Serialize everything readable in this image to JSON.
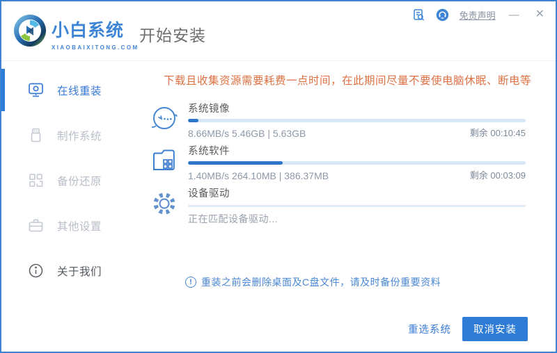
{
  "header": {
    "brand_name": "小白系统",
    "brand_domain": "XIAOBAIXITONG.COM",
    "page_title": "开始安装",
    "disclaimer": "免责声明",
    "minimize": "—",
    "close": "✕"
  },
  "sidebar": {
    "items": [
      {
        "label": "在线重装",
        "icon": "monitor-icon",
        "active": true
      },
      {
        "label": "制作系统",
        "icon": "usb-icon",
        "active": false
      },
      {
        "label": "备份还原",
        "icon": "blocks-icon",
        "active": false
      },
      {
        "label": "其他设置",
        "icon": "briefcase-icon",
        "active": false
      },
      {
        "label": "关于我们",
        "icon": "info-icon",
        "active": false
      }
    ]
  },
  "main": {
    "warning": "下载且收集资源需要耗费一点时间，在此期间尽量不要使电脑休眠、断电等",
    "tasks": [
      {
        "name": "系统镜像",
        "stats": "8.66MB/s 5.46GB | 5.63GB",
        "remaining": "剩余 00:10:45",
        "progress": 3
      },
      {
        "name": "系统软件",
        "stats": "1.40MB/s 264.10MB | 386.37MB",
        "remaining": "剩余 00:03:09",
        "progress": 28
      },
      {
        "name": "设备驱动",
        "status": "正在匹配设备驱动...",
        "progress": 0
      }
    ],
    "notice_mark": "!",
    "notice": "重装之前会删除桌面及C盘文件，请及时备份重要资料"
  },
  "footer": {
    "reselect_label": "重选系统",
    "cancel_label": "取消安装"
  },
  "colors": {
    "accent": "#3E85D6",
    "accent2": "#3A7BD5",
    "accent_dark": "#2E7CD6",
    "fill_blue": "#2E76C8",
    "border_blue": "#3E82D8",
    "warning_text": "#DC7244",
    "track": "#D9E6F5",
    "title_gray": "#6E6E6E",
    "text_dark": "#5B5B5B",
    "text_gray": "#8E99A8",
    "text_light": "#B9BEC8",
    "notice_blue": "#4A88D4",
    "muted": "#9AA3AD",
    "about": "#54585F"
  }
}
